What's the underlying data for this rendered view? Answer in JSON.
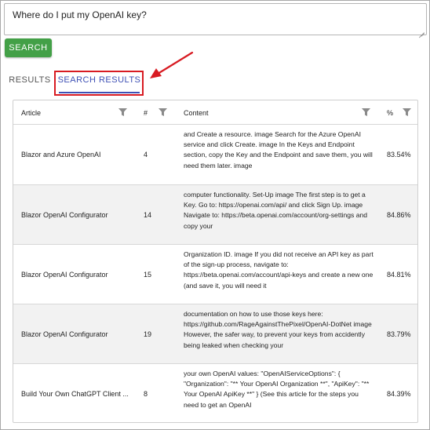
{
  "search": {
    "query": "Where do I put my OpenAI key?",
    "button_label": "SEARCH"
  },
  "tabs": [
    {
      "label": "RESULTS",
      "active": false
    },
    {
      "label": "SEARCH RESULTS",
      "active": true
    }
  ],
  "colors": {
    "accent": "#3f51b5",
    "button": "#43a047",
    "annotation": "#d81b22"
  },
  "table": {
    "columns": {
      "article": "Article",
      "number": "#",
      "content": "Content",
      "percent": "%"
    },
    "rows": [
      {
        "article": "Blazor and Azure OpenAI",
        "number": "4",
        "content": "and Create a resource. image Search for the Azure OpenAI service and click Create. image In the Keys and Endpoint section, copy the Key and the Endpoint and save them, you will need them later. image",
        "percent": "83.54%"
      },
      {
        "article": "Blazor OpenAI Configurator",
        "number": "14",
        "content": "computer functionality. Set-Up image The first step is to get a Key. Go to: https://openai.com/api/ and click Sign Up. image Navigate to: https://beta.openai.com/account/org-settings and copy your",
        "percent": "84.86%"
      },
      {
        "article": "Blazor OpenAI Configurator",
        "number": "15",
        "content": "Organization ID. image If you did not receive an API key as part of the sign-up process, navigate to: https://beta.openai.com/account/api-keys and create a new one (and save it, you will need it",
        "percent": "84.81%"
      },
      {
        "article": "Blazor OpenAI Configurator",
        "number": "19",
        "content": "documentation on how to use those keys here: https://github.com/RageAgainstThePixel/OpenAI-DotNet image However, the safer way, to prevent your keys from accidently being leaked when checking your",
        "percent": "83.79%"
      },
      {
        "article": "Build Your Own ChatGPT Client ...",
        "number": "8",
        "content": "your own OpenAI values: \"OpenAIServiceOptions\": { \"Organization\": \"** Your OpenAI Organization **\", \"ApiKey\": \"** Your OpenAI ApiKey **\" } (See this article for the steps you need to get an OpenAI",
        "percent": "84.39%"
      }
    ]
  }
}
